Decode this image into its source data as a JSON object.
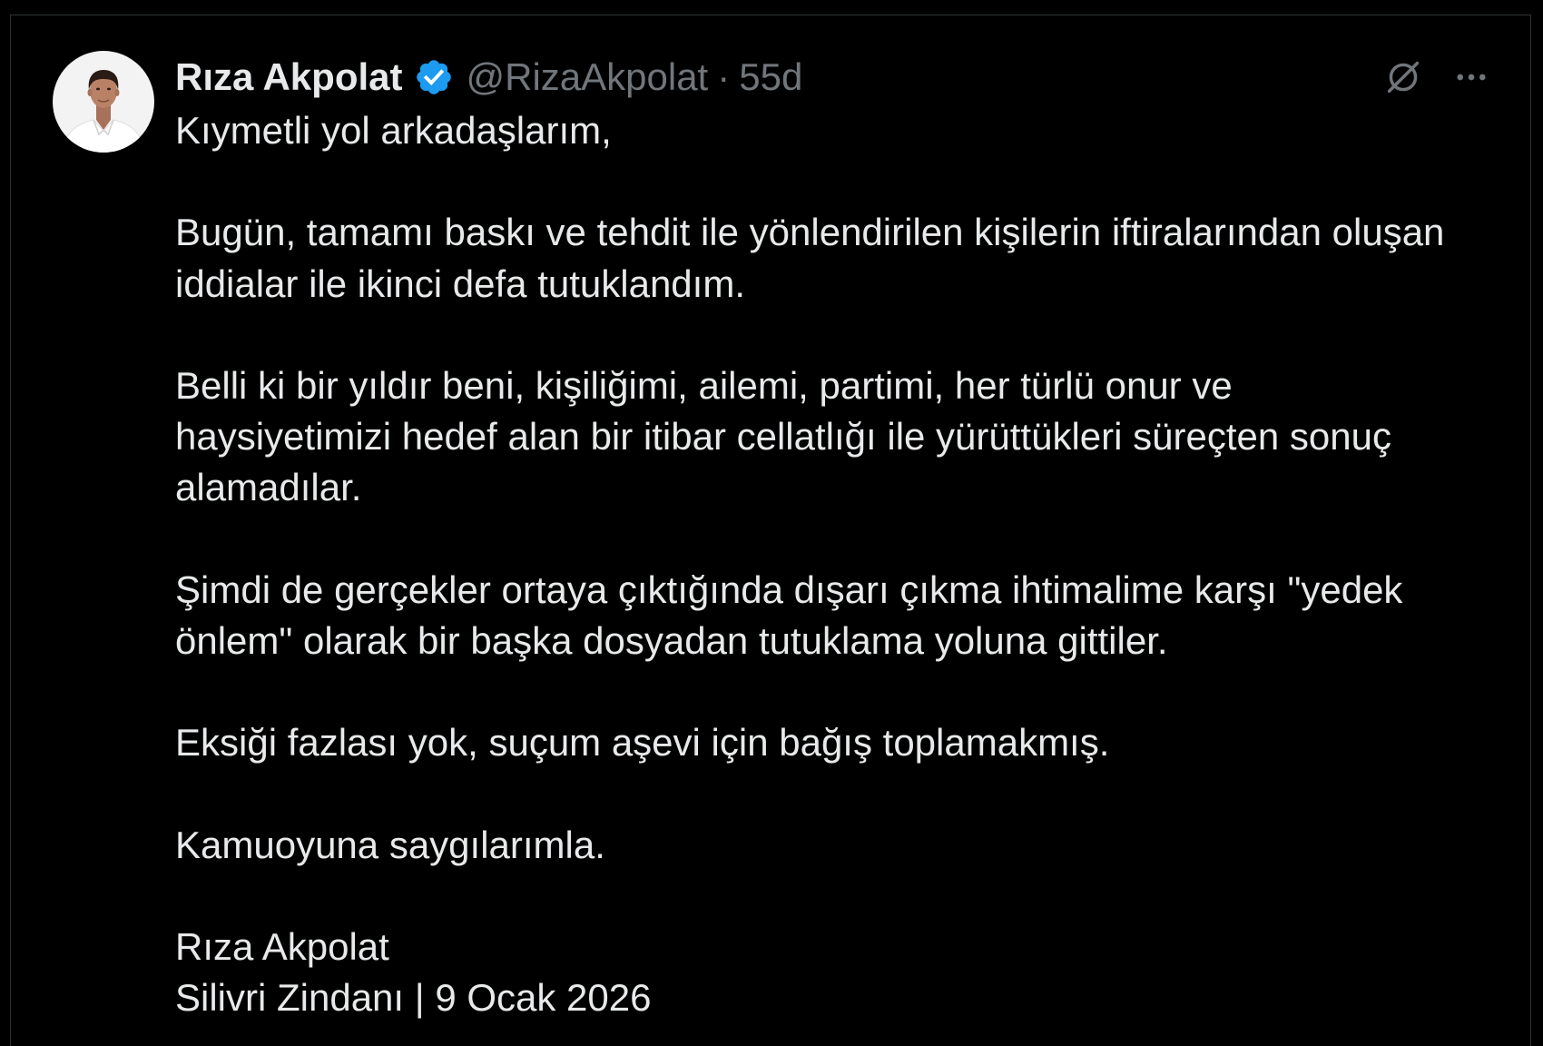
{
  "author": {
    "name": "Rıza Akpolat",
    "handle": "@RizaAkpolat",
    "verified": true,
    "avatar": "profile-photo"
  },
  "tweet": {
    "separator": "·",
    "time": "55d",
    "paragraphs": [
      [
        "Kıymetli yol arkadaşlarım,"
      ],
      [
        "Bugün, tamamı baskı ve tehdit ile yönlendirilen kişilerin iftiralarından oluşan",
        "iddialar ile ikinci defa tutuklandım."
      ],
      [
        "Belli ki bir yıldır beni, kişiliğimi, ailemi, partimi, her türlü onur ve",
        "haysiyetimizi hedef alan bir itibar cellatlığı ile yürüttükleri süreçten sonuç",
        "alamadılar."
      ],
      [
        "Şimdi de gerçekler ortaya çıktığında dışarı çıkma ihtimalime karşı \"yedek",
        "önlem\" olarak bir başka dosyadan tutuklama yoluna gittiler."
      ],
      [
        "Eksiği fazlası yok, suçum aşevi için bağış toplamakmış."
      ],
      [
        "Kamuoyuna saygılarımla."
      ],
      [
        "Rıza Akpolat",
        "Silivri Zindanı | 9 Ocak 2026"
      ]
    ]
  },
  "icons": {
    "verified": "verified-badge-icon",
    "grok": "grok-icon",
    "more": "more-options-icon"
  },
  "colors": {
    "background": "#000000",
    "text": "#e7e9ea",
    "muted": "#71767b",
    "accent": "#1d9bf0",
    "border": "#2f3336"
  }
}
